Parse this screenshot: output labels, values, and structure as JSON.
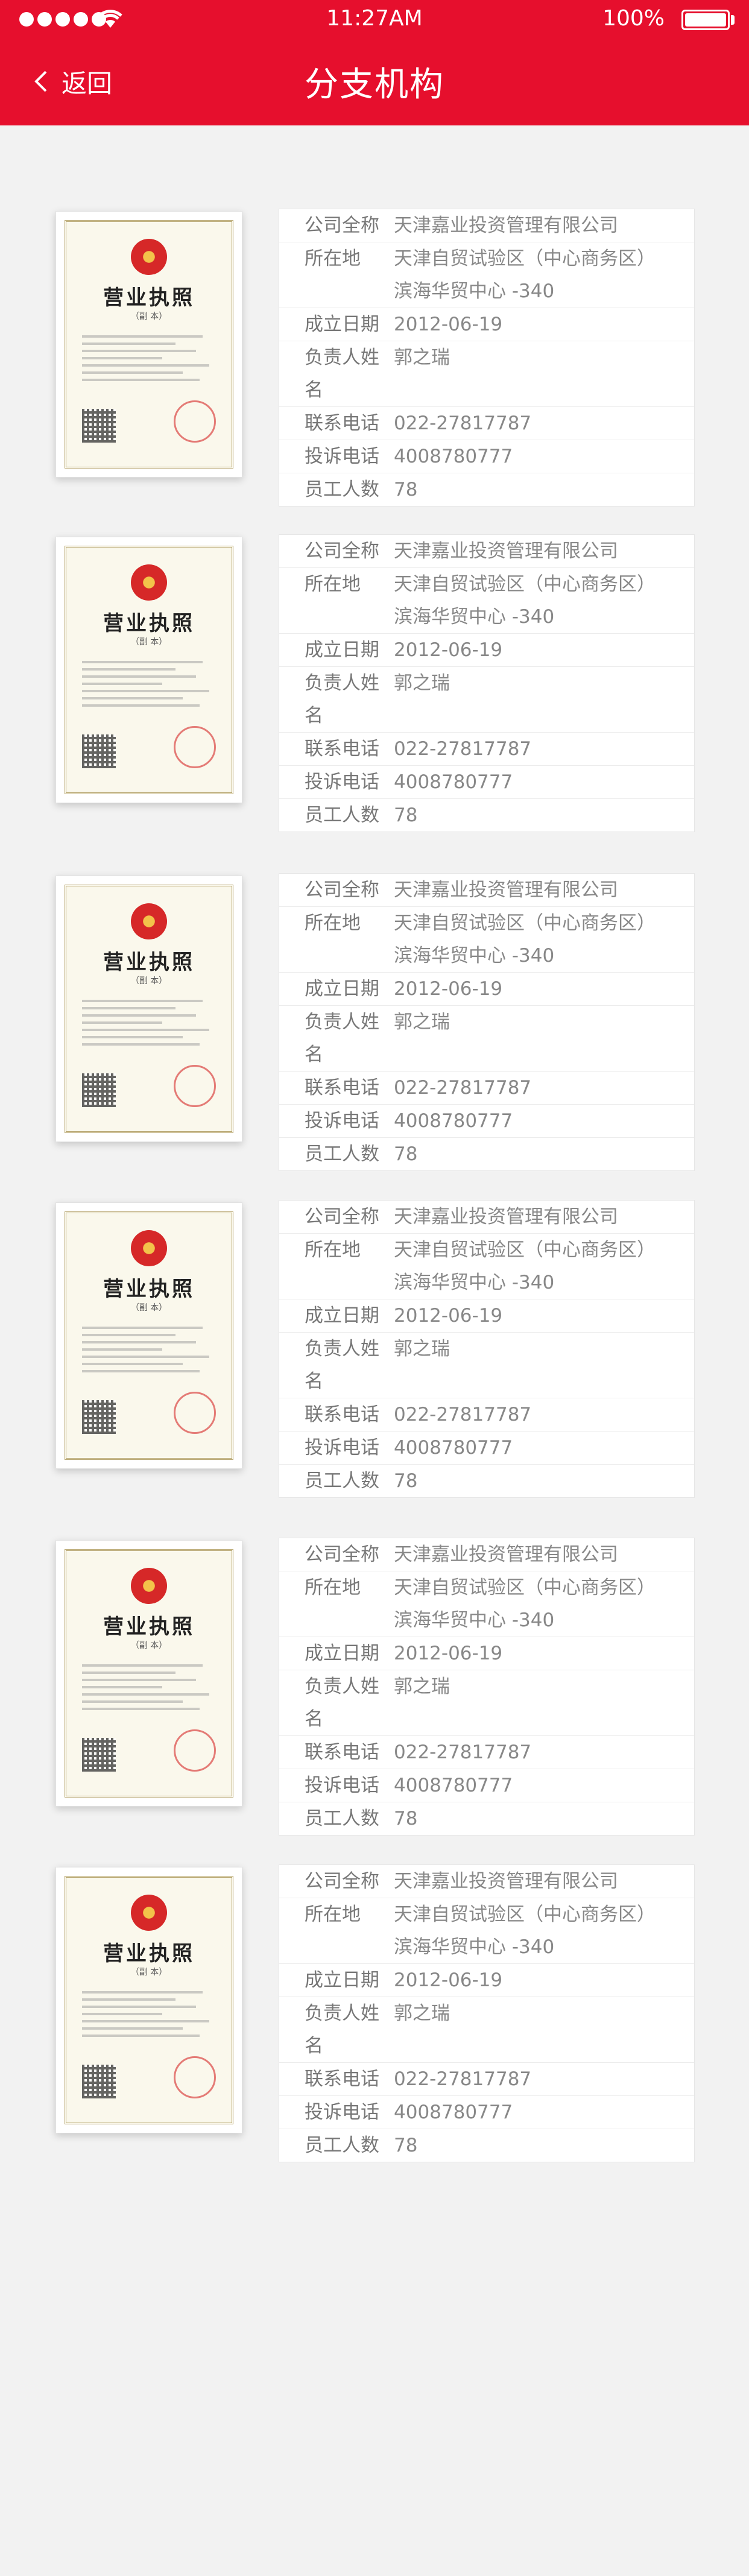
{
  "status_bar": {
    "time": "11:27AM",
    "battery": "100%"
  },
  "header": {
    "back_label": "返回",
    "title": "分支机构",
    "color": "#e60f2d"
  },
  "license_card": {
    "title": "营业执照",
    "subtitle": "（副 本）"
  },
  "labels": {
    "full_name": "公司全称",
    "address": "所在地",
    "founded": "成立日期",
    "manager": "负责人姓名",
    "phone": "联系电话",
    "complaint": "投诉电话",
    "employees": "员工人数"
  },
  "branches": [
    {
      "full_name": "天津嘉业投资管理有限公司",
      "address_line1": "天津自贸试验区（中心商务区）",
      "address_line2": "滨海华贸中心 -340",
      "founded": "2012-06-19",
      "manager": "郭之瑞",
      "phone": "022-27817787",
      "complaint": "4008780777",
      "employees": "78"
    },
    {
      "full_name": "天津嘉业投资管理有限公司",
      "address_line1": "天津自贸试验区（中心商务区）",
      "address_line2": "滨海华贸中心 -340",
      "founded": "2012-06-19",
      "manager": "郭之瑞",
      "phone": "022-27817787",
      "complaint": "4008780777",
      "employees": "78"
    },
    {
      "full_name": "天津嘉业投资管理有限公司",
      "address_line1": "天津自贸试验区（中心商务区）",
      "address_line2": "滨海华贸中心 -340",
      "founded": "2012-06-19",
      "manager": "郭之瑞",
      "phone": "022-27817787",
      "complaint": "4008780777",
      "employees": "78"
    },
    {
      "full_name": "天津嘉业投资管理有限公司",
      "address_line1": "天津自贸试验区（中心商务区）",
      "address_line2": "滨海华贸中心 -340",
      "founded": "2012-06-19",
      "manager": "郭之瑞",
      "phone": "022-27817787",
      "complaint": "4008780777",
      "employees": "78"
    },
    {
      "full_name": "天津嘉业投资管理有限公司",
      "address_line1": "天津自贸试验区（中心商务区）",
      "address_line2": "滨海华贸中心 -340",
      "founded": "2012-06-19",
      "manager": "郭之瑞",
      "phone": "022-27817787",
      "complaint": "4008780777",
      "employees": "78"
    },
    {
      "full_name": "天津嘉业投资管理有限公司",
      "address_line1": "天津自贸试验区（中心商务区）",
      "address_line2": "滨海华贸中心 -340",
      "founded": "2012-06-19",
      "manager": "郭之瑞",
      "phone": "022-27817787",
      "complaint": "4008780777",
      "employees": "78"
    }
  ]
}
